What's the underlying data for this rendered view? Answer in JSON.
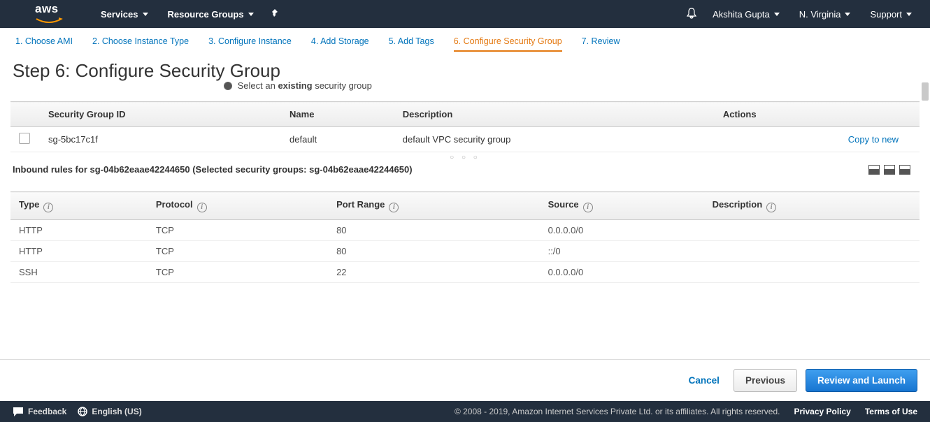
{
  "navbar": {
    "services": "Services",
    "resource_groups": "Resource Groups",
    "user": "Akshita Gupta",
    "region": "N. Virginia",
    "support": "Support"
  },
  "steps": [
    {
      "label": "1. Choose AMI"
    },
    {
      "label": "2. Choose Instance Type"
    },
    {
      "label": "3. Configure Instance"
    },
    {
      "label": "4. Add Storage"
    },
    {
      "label": "5. Add Tags"
    },
    {
      "label": "6. Configure Security Group"
    },
    {
      "label": "7. Review"
    }
  ],
  "page_title": "Step 6: Configure Security Group",
  "radio_row": {
    "prefix": "Select an ",
    "strong": "existing",
    "suffix": " security group"
  },
  "sg_table": {
    "headers": {
      "id": "Security Group ID",
      "name": "Name",
      "description": "Description",
      "actions": "Actions"
    },
    "rows": [
      {
        "id": "sg-5bc17c1f",
        "name": "default",
        "description": "default VPC security group",
        "action": "Copy to new"
      }
    ]
  },
  "inbound_label": "Inbound rules for sg-04b62eaae42244650 (Selected security groups: sg-04b62eaae42244650)",
  "rules_table": {
    "headers": {
      "type": "Type",
      "protocol": "Protocol",
      "port_range": "Port Range",
      "source": "Source",
      "description": "Description"
    },
    "rows": [
      {
        "type": "HTTP",
        "protocol": "TCP",
        "port_range": "80",
        "source": "0.0.0.0/0",
        "description": ""
      },
      {
        "type": "HTTP",
        "protocol": "TCP",
        "port_range": "80",
        "source": "::/0",
        "description": ""
      },
      {
        "type": "SSH",
        "protocol": "TCP",
        "port_range": "22",
        "source": "0.0.0.0/0",
        "description": ""
      }
    ]
  },
  "buttons": {
    "cancel": "Cancel",
    "previous": "Previous",
    "review": "Review and Launch"
  },
  "footer": {
    "feedback": "Feedback",
    "language": "English (US)",
    "copyright": "© 2008 - 2019, Amazon Internet Services Private Ltd. or its affiliates. All rights reserved.",
    "privacy": "Privacy Policy",
    "terms": "Terms of Use"
  }
}
